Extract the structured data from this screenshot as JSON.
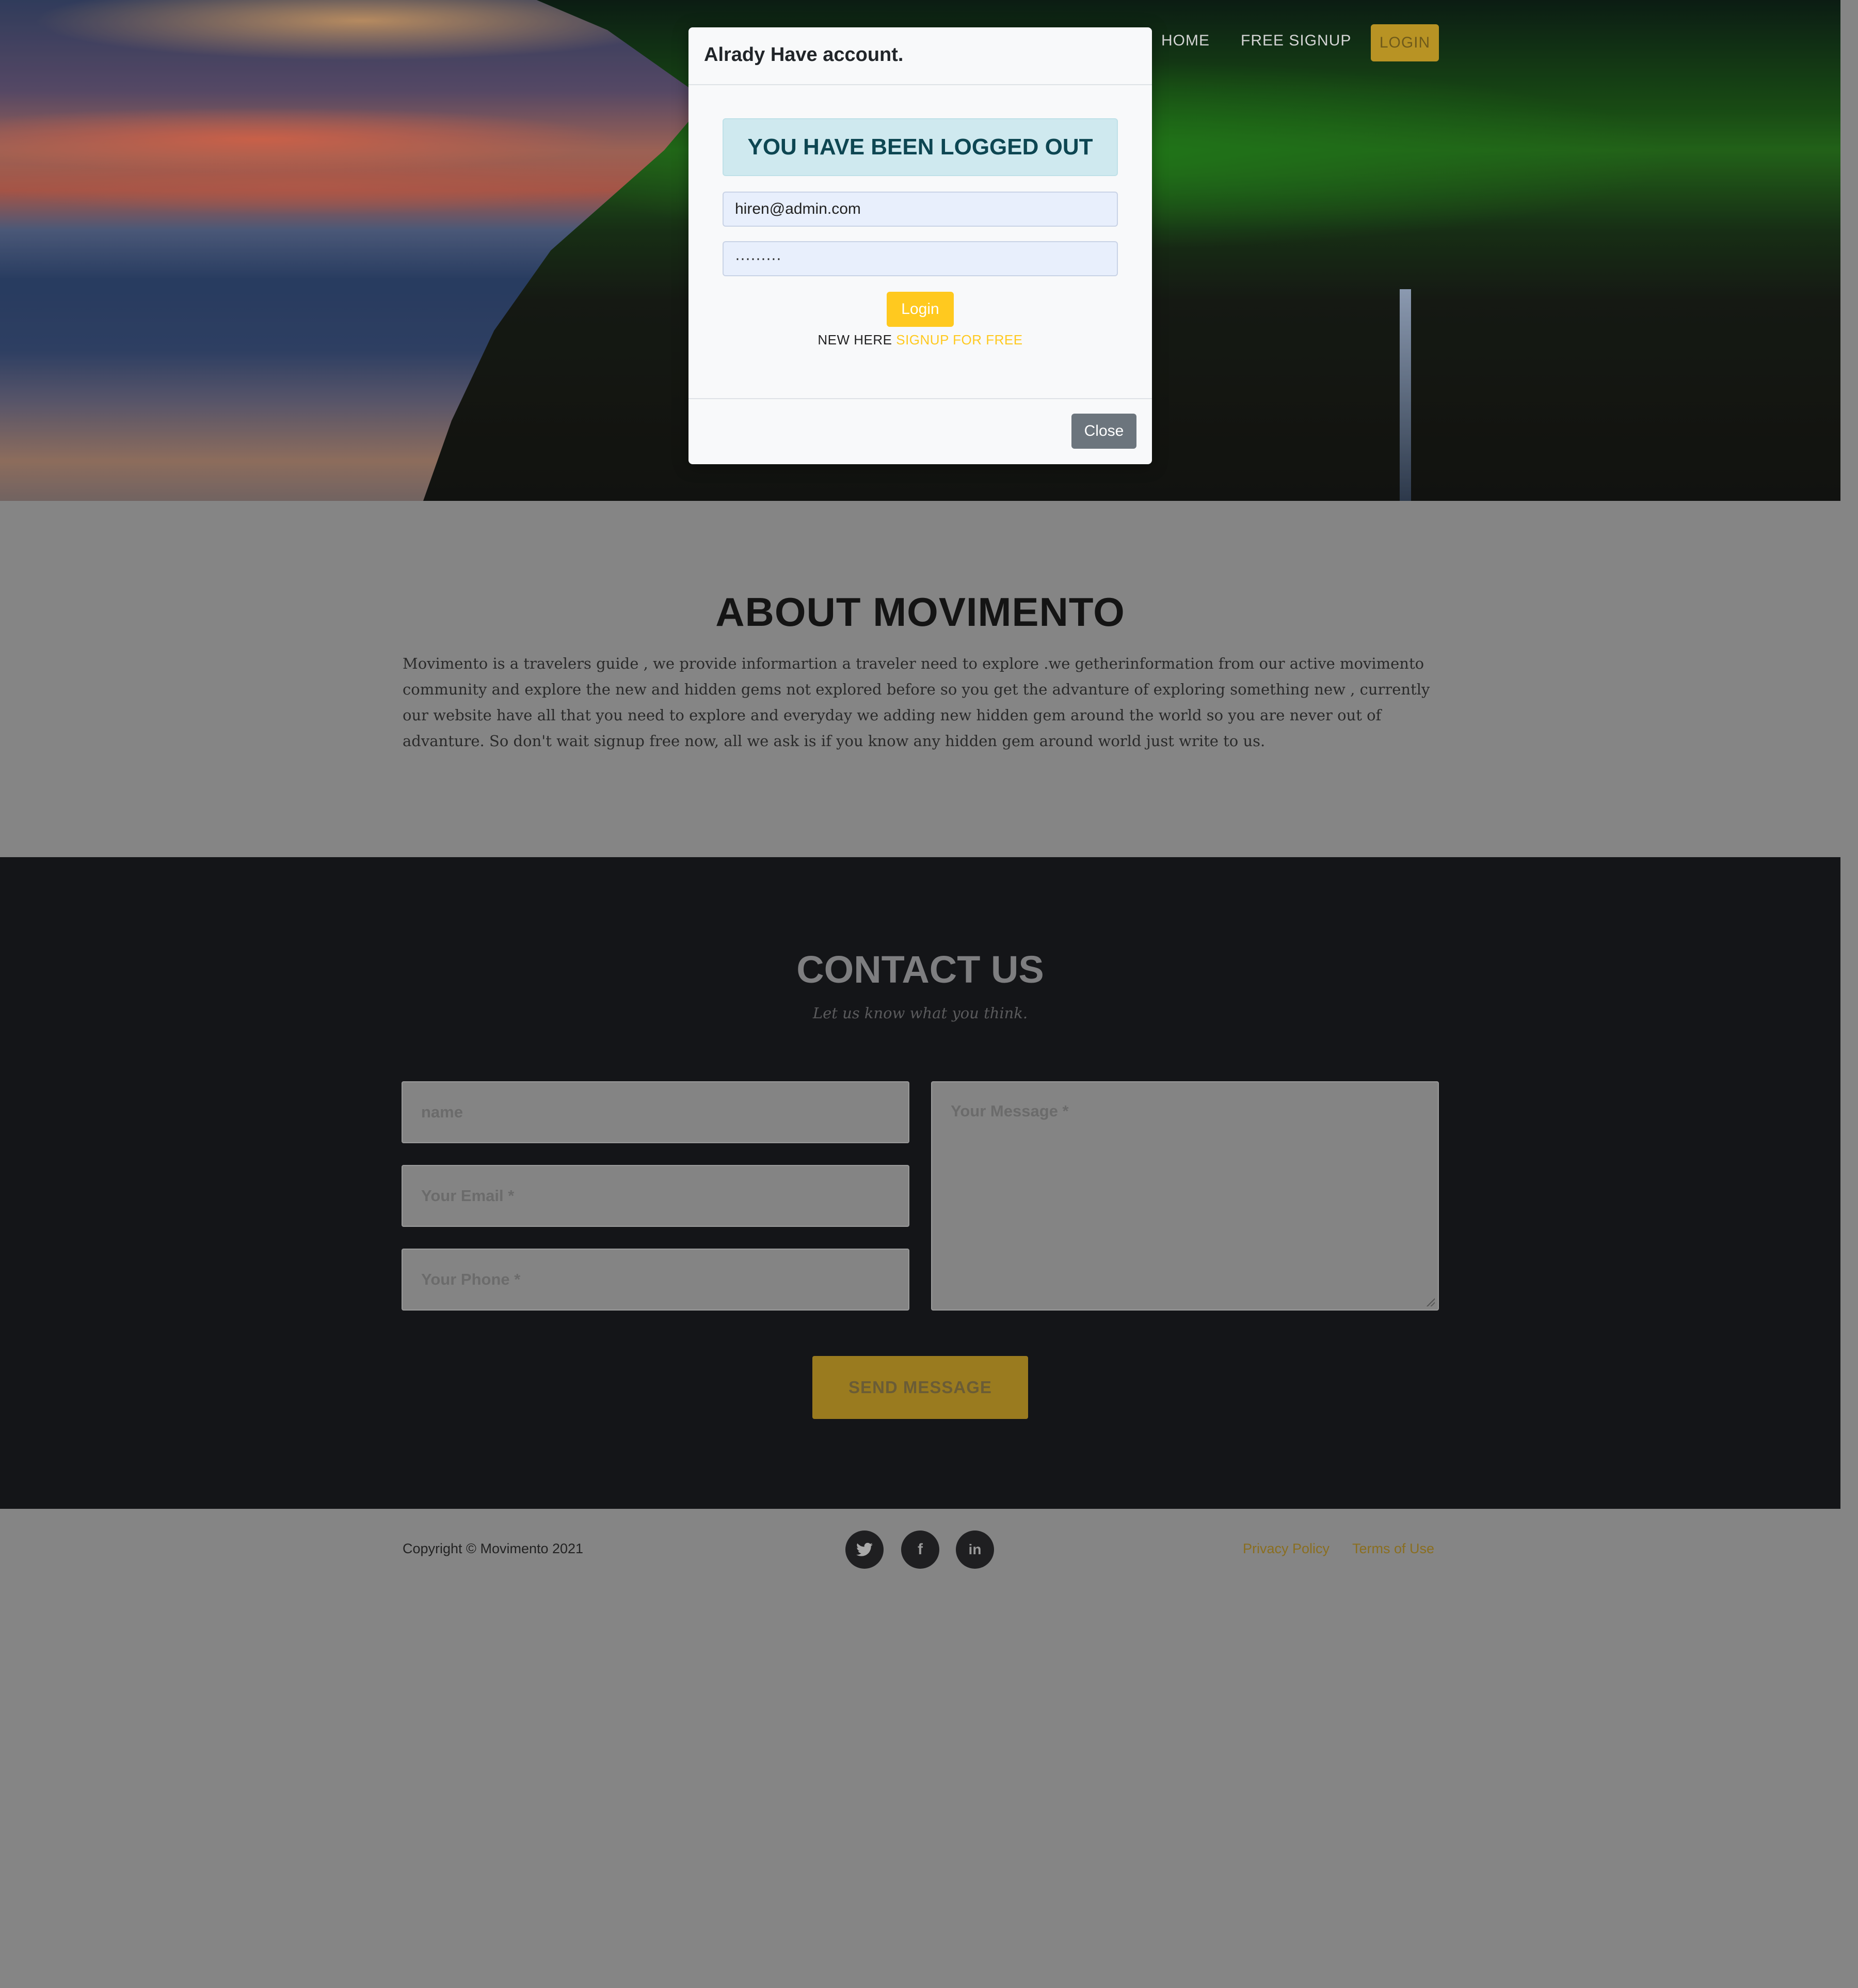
{
  "nav": {
    "home": "HOME",
    "signup": "FREE SIGNUP",
    "login": "LOGIN"
  },
  "modal": {
    "title": "Alrady Have account.",
    "alert": "YOU HAVE BEEN LOGGED OUT",
    "email_value": "hiren@admin.com",
    "password_value": "·········",
    "login_button": "Login",
    "new_here": "NEW HERE",
    "signup_link": "SIGNUP FOR FREE",
    "close_button": "Close"
  },
  "about": {
    "title": "ABOUT MOVIMENTO",
    "text": "Movimento is a travelers guide , we provide informartion a traveler need to explore .we getherinformation from our active movimento community and explore the new and hidden gems not explored before so you get the advanture of exploring something new , currently our website have all that you need to explore and everyday we adding new hidden gem around the world so you are never out of advanture. So don't wait signup free now, all we ask is if you know any hidden gem around world just write to us."
  },
  "contact": {
    "title": "CONTACT US",
    "subtitle": "Let us know what you think.",
    "name_placeholder": "name",
    "email_placeholder": "Your Email *",
    "phone_placeholder": "Your Phone *",
    "message_placeholder": "Your Message *",
    "send_button": "SEND MESSAGE"
  },
  "footer": {
    "copyright": "Copyright © Movimento 2021",
    "social": [
      {
        "icon": "twitter-icon",
        "glyph": "🐦"
      },
      {
        "icon": "facebook-icon",
        "glyph": "f"
      },
      {
        "icon": "linkedin-icon",
        "glyph": "in"
      }
    ],
    "privacy": "Privacy Policy",
    "terms": "Terms of Use"
  },
  "colors": {
    "accent": "#ffc91f",
    "close_button": "#6c757d",
    "alert_bg": "#cfe9ef",
    "contact_bg": "#141518"
  }
}
